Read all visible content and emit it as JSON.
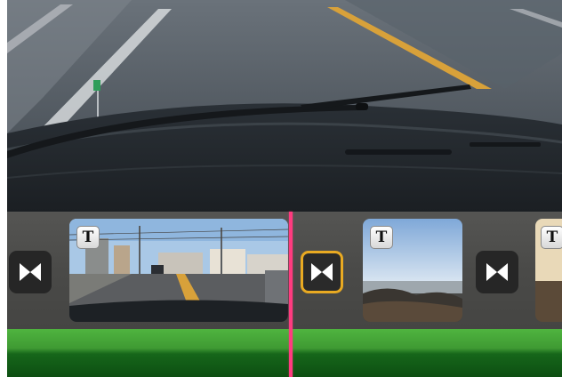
{
  "timeline": {
    "clips": [
      {
        "title_badge": "T"
      },
      {
        "title_badge": "T"
      },
      {
        "title_badge": "T"
      }
    ]
  },
  "colors": {
    "playhead": "#ff3b7f",
    "selected_transition": "#e9aa22",
    "audio_track": "#3f9a33"
  }
}
